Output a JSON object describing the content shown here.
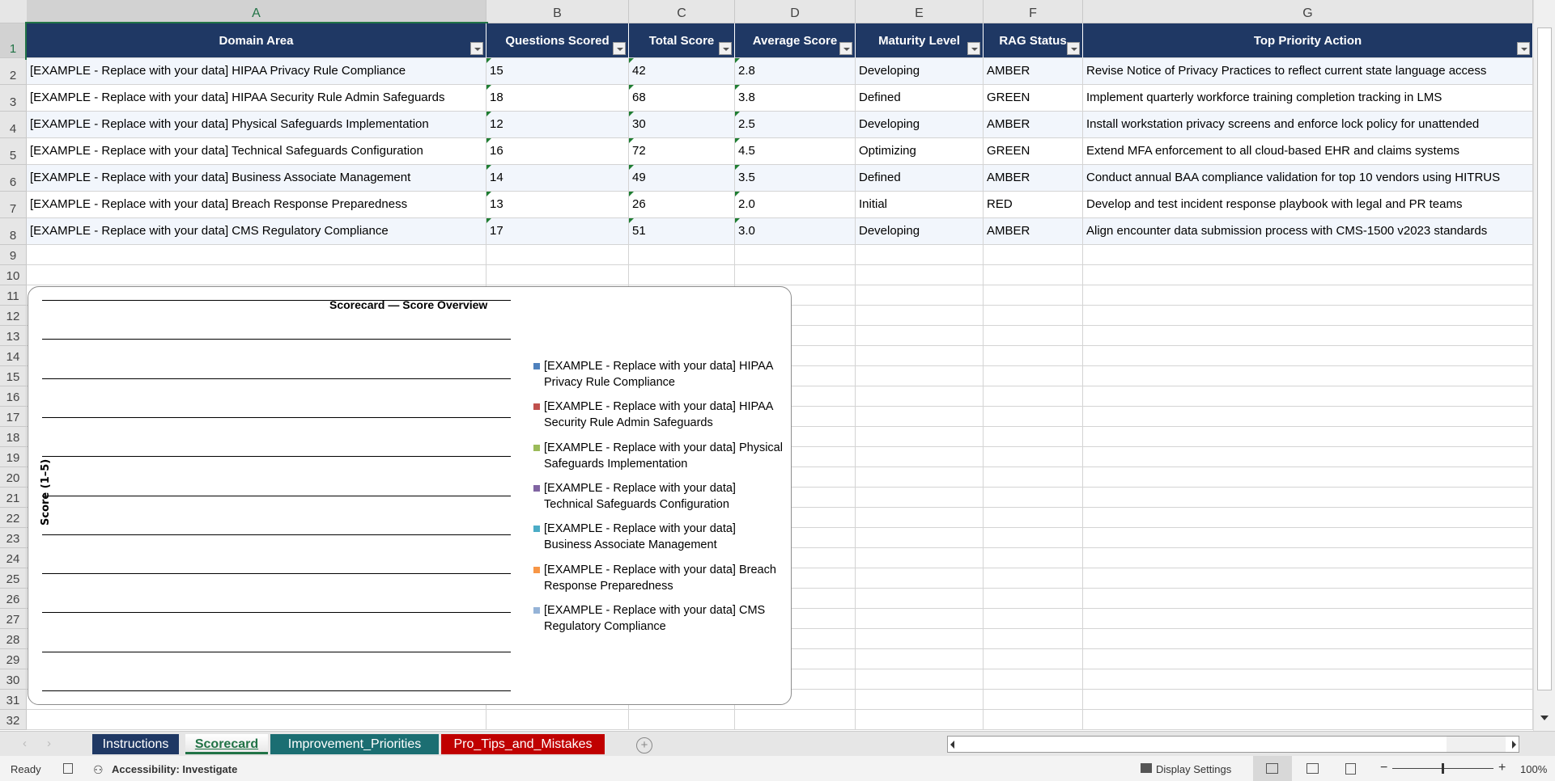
{
  "columns": [
    "A",
    "B",
    "C",
    "D",
    "E",
    "F",
    "G"
  ],
  "headers": [
    "Domain Area",
    "Questions Scored",
    "Total Score",
    "Average Score",
    "Maturity Level",
    "RAG Status",
    "Top Priority Action"
  ],
  "rows": [
    [
      "[EXAMPLE - Replace with your data] HIPAA Privacy Rule Compliance",
      "15",
      "42",
      "2.8",
      "Developing",
      "AMBER",
      "Revise Notice of Privacy Practices to reflect current state language access"
    ],
    [
      "[EXAMPLE - Replace with your data] HIPAA Security Rule Admin Safeguards",
      "18",
      "68",
      "3.8",
      "Defined",
      "GREEN",
      "Implement quarterly workforce training completion tracking in LMS"
    ],
    [
      "[EXAMPLE - Replace with your data] Physical Safeguards Implementation",
      "12",
      "30",
      "2.5",
      "Developing",
      "AMBER",
      "Install workstation privacy screens and enforce lock policy for unattended"
    ],
    [
      "[EXAMPLE - Replace with your data] Technical Safeguards Configuration",
      "16",
      "72",
      "4.5",
      "Optimizing",
      "GREEN",
      "Extend MFA enforcement to all cloud-based EHR and claims systems"
    ],
    [
      "[EXAMPLE - Replace with your data] Business Associate Management",
      "14",
      "49",
      "3.5",
      "Defined",
      "AMBER",
      "Conduct annual BAA compliance validation for top 10 vendors using HITRUS"
    ],
    [
      "[EXAMPLE - Replace with your data] Breach Response Preparedness",
      "13",
      "26",
      "2.0",
      "Initial",
      "RED",
      "Develop and test incident response playbook with legal and PR teams"
    ],
    [
      "[EXAMPLE - Replace with your data] CMS Regulatory Compliance",
      "17",
      "51",
      "3.0",
      "Developing",
      "AMBER",
      "Align encounter data submission process with CMS-1500 v2023 standards"
    ]
  ],
  "row_numbers": [
    "1",
    "2",
    "3",
    "4",
    "5",
    "6",
    "7",
    "8",
    "9",
    "10",
    "11",
    "12",
    "13",
    "14",
    "15",
    "16",
    "17",
    "18",
    "19",
    "20",
    "21",
    "22",
    "23",
    "24",
    "25",
    "26",
    "27",
    "28",
    "29",
    "30",
    "31",
    "32"
  ],
  "chart": {
    "title": "Scorecard — Score Overview",
    "ylabel": "Score (1–5)",
    "legend": [
      {
        "label": "[EXAMPLE - Replace with your data] HIPAA Privacy Rule Compliance",
        "color": "#4f81bd"
      },
      {
        "label": "[EXAMPLE - Replace with your data] HIPAA Security Rule Admin Safeguards",
        "color": "#c0504d"
      },
      {
        "label": "[EXAMPLE - Replace with your data] Physical Safeguards Implementation",
        "color": "#9bbb59"
      },
      {
        "label": "[EXAMPLE - Replace with your data] Technical Safeguards Configuration",
        "color": "#8064a2"
      },
      {
        "label": "[EXAMPLE - Replace with your data] Business Associate Management",
        "color": "#4bacc6"
      },
      {
        "label": "[EXAMPLE - Replace with your data] Breach Response Preparedness",
        "color": "#f79646"
      },
      {
        "label": "[EXAMPLE - Replace with your data] CMS Regulatory Compliance",
        "color": "#95b3d7"
      }
    ]
  },
  "sheet_tabs": [
    {
      "label": "Instructions",
      "color": "#1f3864",
      "active": false
    },
    {
      "label": "Scorecard",
      "color": "#ffffff",
      "active": true
    },
    {
      "label": "Improvement_Priorities",
      "color": "#1b6e72",
      "active": false
    },
    {
      "label": "Pro_Tips_and_Mistakes",
      "color": "#c00000",
      "active": false
    }
  ],
  "status": {
    "ready": "Ready",
    "accessibility": "Accessibility: Investigate",
    "display_settings": "Display Settings",
    "zoom": "100%"
  }
}
